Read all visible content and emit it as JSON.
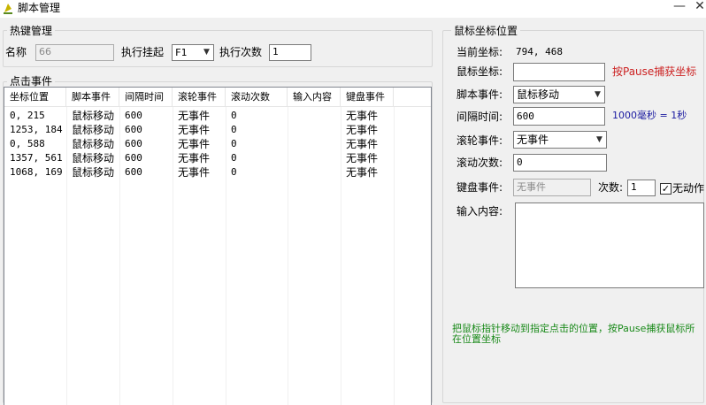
{
  "window": {
    "title": "脚本管理",
    "minimize_glyph": "—",
    "close_glyph": "✕"
  },
  "hotkey": {
    "group_title": "热键管理",
    "name_label": "名称",
    "name_value": "66",
    "trigger_label": "执行挂起",
    "trigger_value": "F1",
    "count_label": "执行次数",
    "count_value": "1"
  },
  "events": {
    "group_title": "点击事件",
    "columns": [
      "坐标位置",
      "脚本事件",
      "间隔时间",
      "滚轮事件",
      "滚动次数",
      "输入内容",
      "键盘事件"
    ],
    "rows": [
      [
        "0, 215",
        "鼠标移动",
        "600",
        "无事件",
        "0",
        "",
        "无事件"
      ],
      [
        "1253, 184",
        "鼠标移动",
        "600",
        "无事件",
        "0",
        "",
        "无事件"
      ],
      [
        "0, 588",
        "鼠标移动",
        "600",
        "无事件",
        "0",
        "",
        "无事件"
      ],
      [
        "1357, 561",
        "鼠标移动",
        "600",
        "无事件",
        "0",
        "",
        "无事件"
      ],
      [
        "1068, 169",
        "鼠标移动",
        "600",
        "无事件",
        "0",
        "",
        "无事件"
      ]
    ]
  },
  "mouse": {
    "group_title": "鼠标坐标位置",
    "current_label": "当前坐标:",
    "current_value": "794, 468",
    "coord_label": "鼠标坐标:",
    "coord_value": "",
    "coord_hint": "按Pause捕获坐标",
    "script_event_label": "脚本事件:",
    "script_event_value": "鼠标移动",
    "interval_label": "间隔时间:",
    "interval_value": "600",
    "interval_hint": "1000毫秒 = 1秒",
    "wheel_label": "滚轮事件:",
    "wheel_value": "无事件",
    "scroll_label": "滚动次数:",
    "scroll_value": "0",
    "keyboard_label": "键盘事件:",
    "keyboard_value": "无事件",
    "times_label": "次数:",
    "times_value": "1",
    "no_action_label": "无动作",
    "no_action_checked": true,
    "input_label": "输入内容:",
    "input_value": "",
    "help_text": "把鼠标指针移动到指定点击的位置，按Pause捕获鼠标所在位置坐标"
  },
  "colors": {
    "red_hint": "#cc2222",
    "blue_hint": "#1a1aa0",
    "green_help": "#1a8a1a"
  },
  "icons": {
    "app": "app-icon",
    "dropdown": "chevron-down-icon",
    "check": "checkmark-icon"
  }
}
